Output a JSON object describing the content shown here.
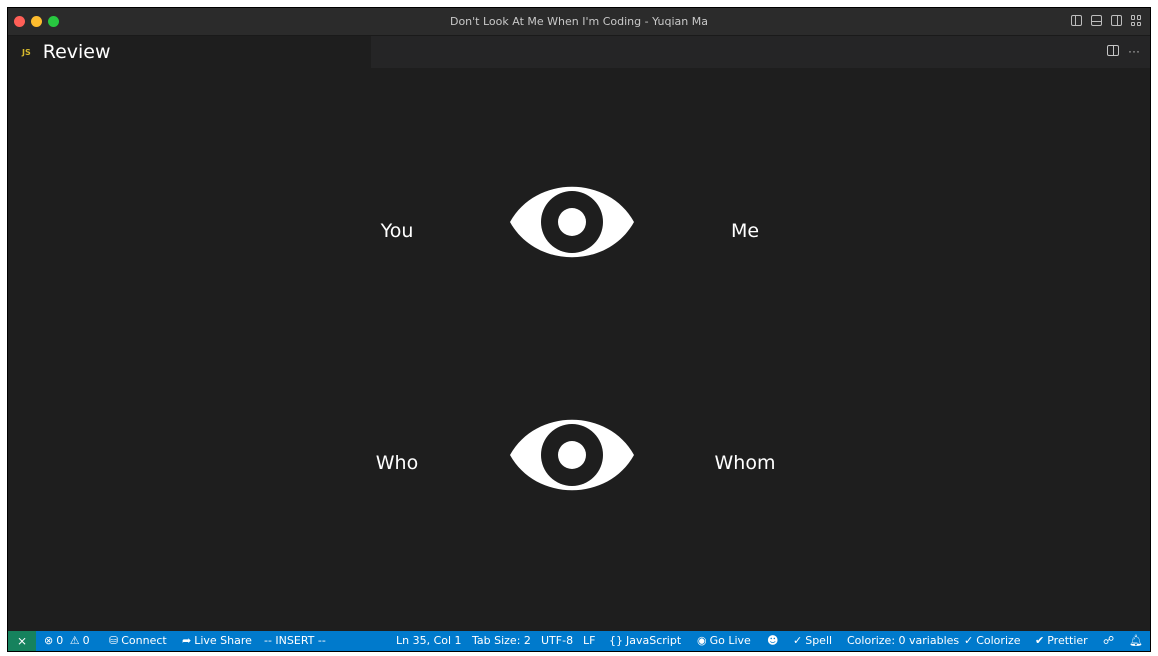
{
  "window": {
    "title": "Don't Look At Me When I'm Coding - Yuqian Ma"
  },
  "tab": {
    "icon_label": "JS",
    "label": "Review"
  },
  "canvas": {
    "words": {
      "top_left": "You",
      "top_right": "Me",
      "bottom_left": "Who",
      "bottom_right": "Whom"
    },
    "eye_color": "#ffffff",
    "background": "#1e1e1e"
  },
  "statusbar": {
    "remote_icon": "remote-icon",
    "errors": "0",
    "warnings": "0",
    "connect": "Connect",
    "live_share": "Live Share",
    "mode": "-- INSERT --",
    "position": "Ln 35, Col 1",
    "tab_size": "Tab Size: 2",
    "encoding": "UTF-8",
    "eol": "LF",
    "language": "JavaScript",
    "go_live": "Go Live",
    "spell": "Spell",
    "colorize_vars": "Colorize: 0 variables",
    "colorize": "Colorize",
    "prettier": "Prettier",
    "accent": "#007acc",
    "remote_color": "#16825d"
  }
}
